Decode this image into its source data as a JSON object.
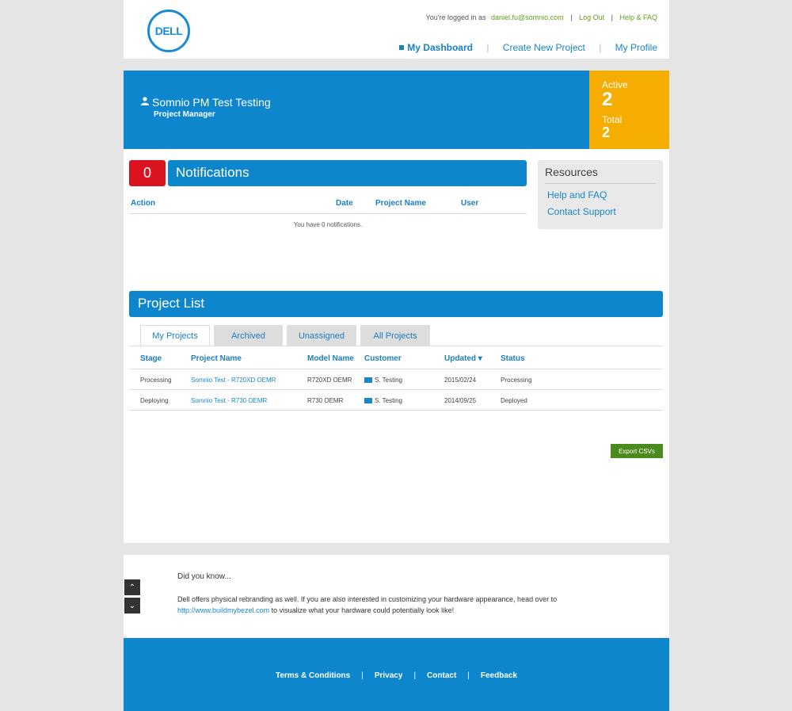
{
  "brand": {
    "logo_text": "DELL",
    "accent": "#0d86ce",
    "stats_color": "#f4ad00",
    "alert_color": "#d9141e"
  },
  "userbar": {
    "prefix": "You're logged in as",
    "email": "daniel.fu@somnio.com",
    "logout": "Log Out",
    "help": "Help & FAQ"
  },
  "nav": {
    "dashboard": "My Dashboard",
    "create": "Create New Project",
    "profile": "My Profile"
  },
  "banner": {
    "name": "Somnio PM Test Testing",
    "role": "Project Manager",
    "user_icon": "user-icon"
  },
  "stats": {
    "active_label": "Active",
    "active_value": "2",
    "total_label": "Total",
    "total_value": "2"
  },
  "notifications": {
    "count": "0",
    "title": "Notifications",
    "columns": {
      "action": "Action",
      "date": "Date",
      "project": "Project Name",
      "user": "User"
    },
    "empty": "You have 0 notifications."
  },
  "resources": {
    "title": "Resources",
    "help": "Help and FAQ",
    "contact": "Contact Support"
  },
  "projects": {
    "title": "Project List",
    "tabs": [
      "My Projects",
      "Archived",
      "Unassigned",
      "All Projects"
    ],
    "columns": {
      "stage": "Stage",
      "name": "Project Name",
      "model": "Model Name",
      "customer": "Customer",
      "updated": "Updated ▾",
      "status": "Status"
    },
    "rows": [
      {
        "stage": "Processing",
        "name": "Somnio Test - R720XD OEMR",
        "model": "R720XD OEMR",
        "customer": "S. Testing",
        "updated": "2015/02/24",
        "status": "Processing"
      },
      {
        "stage": "Deploying",
        "name": "Somnio Test - R730 OEMR",
        "model": "R730 OEMR",
        "customer": "S. Testing",
        "updated": "2014/09/25",
        "status": "Deployed"
      }
    ],
    "export": "Export CSVs"
  },
  "didyouknow": {
    "title": "Did you know...",
    "text_before": "Dell offers physical rebranding as well. If you are also interested in customizing your hardware appearance, head over to",
    "link": "http://www.buildmybezel.com",
    "text_after": "to visualize what your hardware could potentially look like!"
  },
  "footer": {
    "terms": "Terms & Conditions",
    "privacy": "Privacy",
    "contact": "Contact",
    "feedback": "Feedback"
  }
}
